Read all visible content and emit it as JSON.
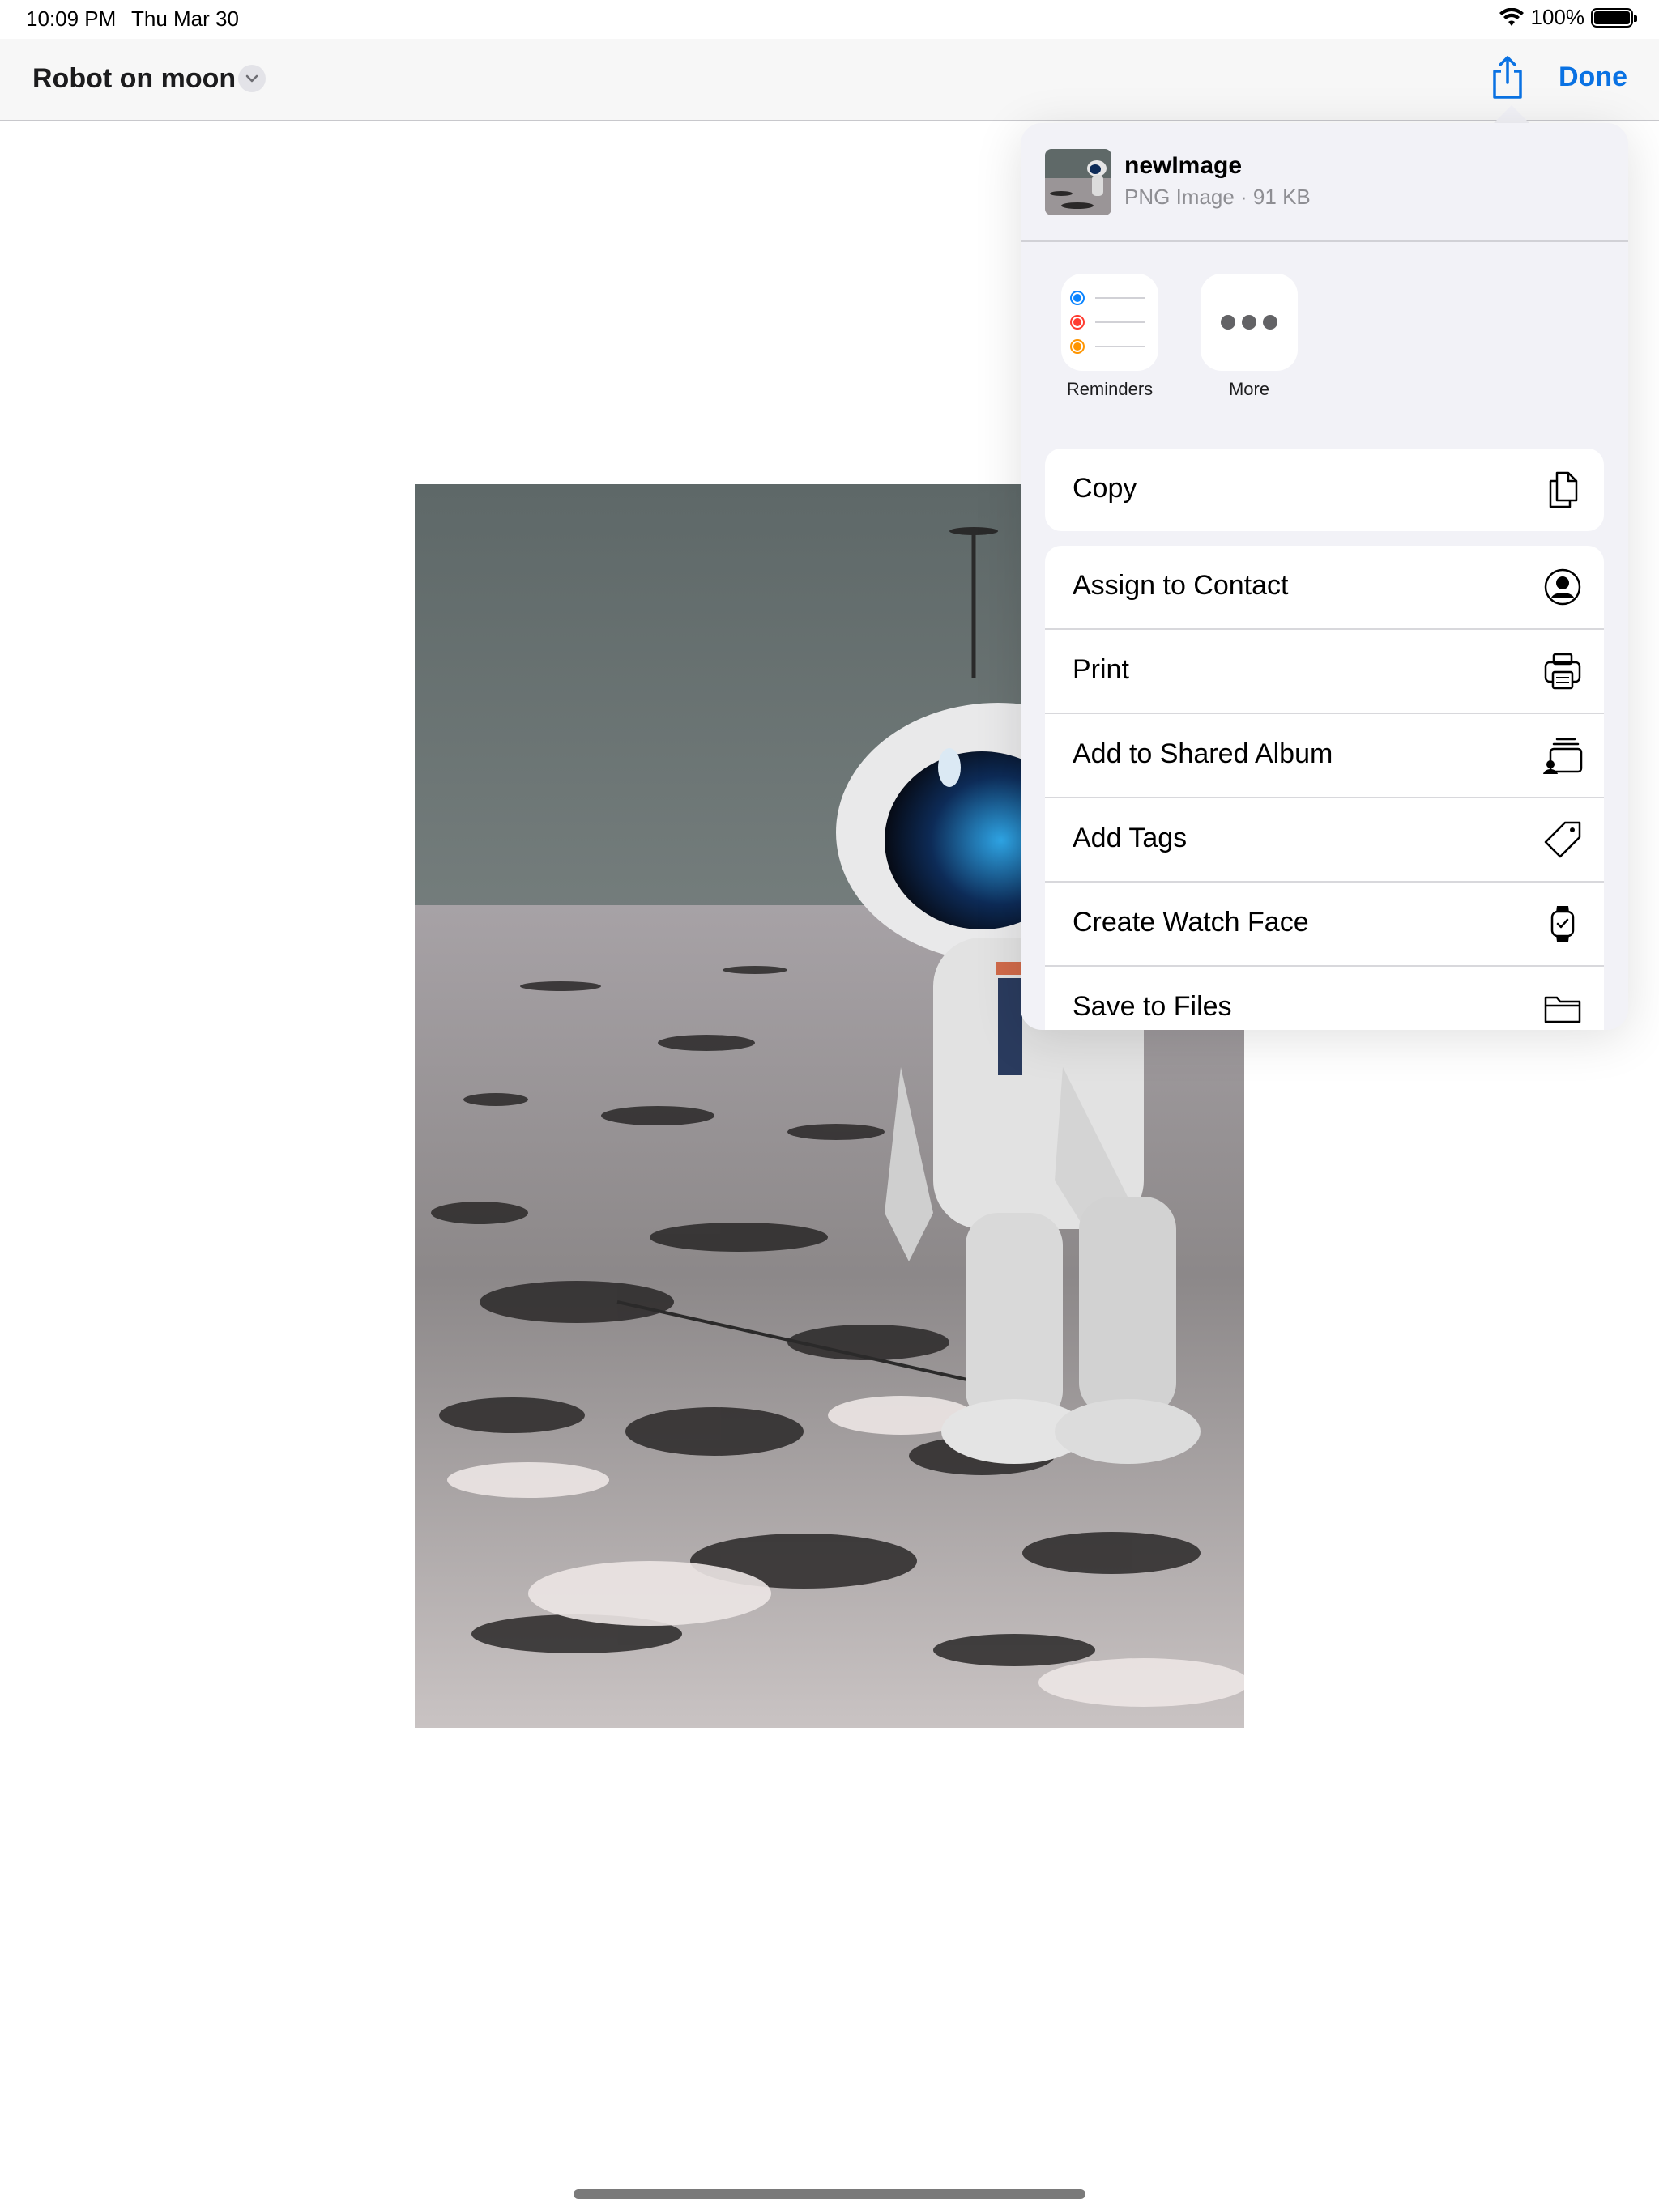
{
  "status_bar": {
    "time": "10:09 PM",
    "date": "Thu Mar 30",
    "battery": "100%"
  },
  "nav": {
    "title": "Robot on moon",
    "done_label": "Done"
  },
  "share_sheet": {
    "file_name": "newImage",
    "file_meta": "PNG Image · 91 KB",
    "apps": [
      {
        "label": "Reminders",
        "icon": "reminders-icon"
      },
      {
        "label": "More",
        "icon": "more-icon"
      }
    ],
    "copy_label": "Copy",
    "actions": [
      {
        "label": "Assign to Contact",
        "icon": "contact-icon"
      },
      {
        "label": "Print",
        "icon": "printer-icon"
      },
      {
        "label": "Add to Shared Album",
        "icon": "shared-album-icon"
      },
      {
        "label": "Add Tags",
        "icon": "tag-icon"
      },
      {
        "label": "Create Watch Face",
        "icon": "watch-icon"
      },
      {
        "label": "Save to Files",
        "icon": "folder-icon"
      }
    ]
  },
  "colors": {
    "accent": "#0a72e3",
    "sheet_bg": "#f2f2f7"
  }
}
